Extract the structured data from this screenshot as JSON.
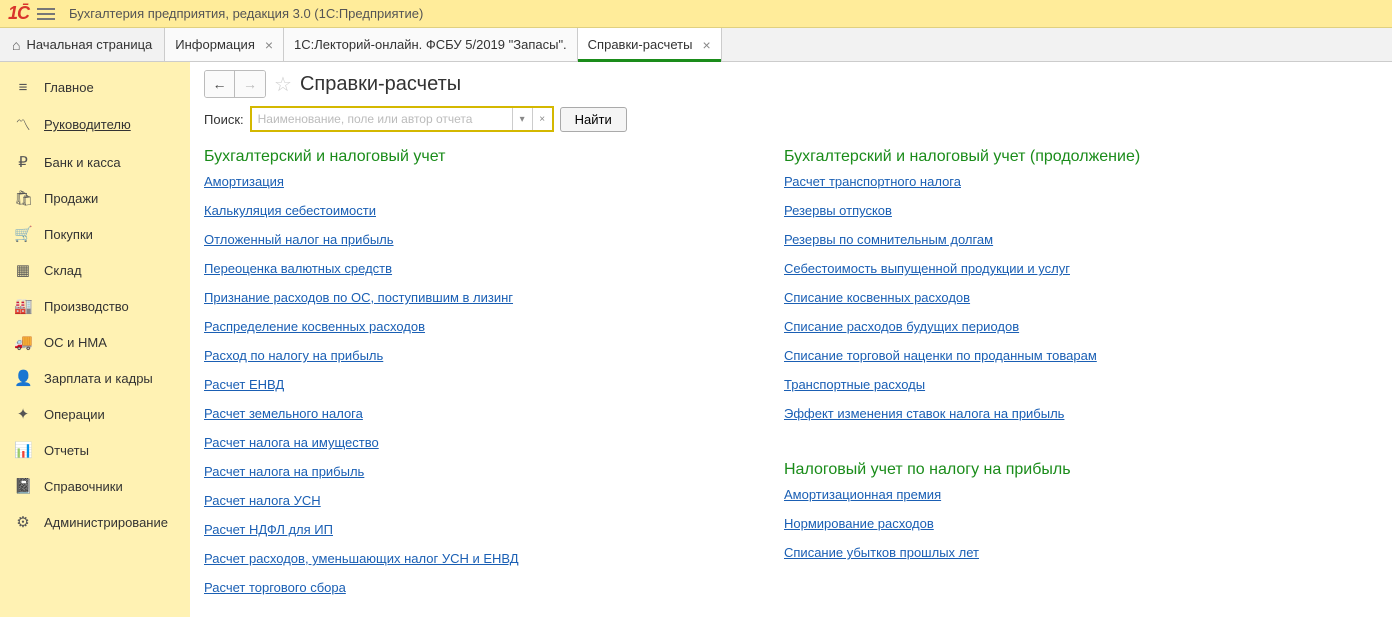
{
  "top": {
    "title": "Бухгалтерия предприятия, редакция 3.0  (1С:Предприятие)"
  },
  "tabs": {
    "home": "Начальная страница",
    "t1": "Информация",
    "t2": "1С:Лекторий-онлайн. ФСБУ 5/2019 \"Запасы\".",
    "t3": "Справки-расчеты"
  },
  "nav": {
    "i0": "Главное",
    "i1": "Руководителю",
    "i2": "Банк и касса",
    "i3": "Продажи",
    "i4": "Покупки",
    "i5": "Склад",
    "i6": "Производство",
    "i7": "ОС и НМА",
    "i8": "Зарплата и кадры",
    "i9": "Операции",
    "i10": "Отчеты",
    "i11": "Справочники",
    "i12": "Администрирование"
  },
  "page": {
    "title": "Справки-расчеты",
    "search_label": "Поиск:",
    "placeholder": "Наименование, поле или автор отчета",
    "find": "Найти"
  },
  "sections": {
    "s1_title": "Бухгалтерский и налоговый учет",
    "s1": {
      "l0": "Амортизация",
      "l1": "Калькуляция себестоимости",
      "l2": "Отложенный налог на прибыль",
      "l3": "Переоценка валютных средств",
      "l4": "Признание расходов по ОС, поступившим в лизинг",
      "l5": "Распределение косвенных расходов",
      "l6": "Расход по налогу на прибыль",
      "l7": "Расчет ЕНВД",
      "l8": "Расчет земельного налога",
      "l9": "Расчет налога на имущество",
      "l10": "Расчет налога на прибыль",
      "l11": "Расчет налога УСН",
      "l12": "Расчет НДФЛ для ИП",
      "l13": "Расчет расходов, уменьшающих налог УСН и ЕНВД",
      "l14": "Расчет торгового сбора"
    },
    "s2_title": "Бухгалтерский и налоговый учет (продолжение)",
    "s2": {
      "l0": "Расчет транспортного налога",
      "l1": "Резервы отпусков",
      "l2": "Резервы по сомнительным долгам",
      "l3": "Себестоимость выпущенной продукции и услуг",
      "l4": "Списание косвенных расходов",
      "l5": "Списание расходов будущих периодов",
      "l6": "Списание торговой наценки по проданным товарам",
      "l7": "Транспортные расходы",
      "l8": "Эффект изменения ставок налога на прибыль"
    },
    "s3_title": "Налоговый учет по налогу на прибыль",
    "s3": {
      "l0": "Амортизационная премия",
      "l1": "Нормирование расходов",
      "l2": "Списание убытков прошлых лет"
    }
  }
}
